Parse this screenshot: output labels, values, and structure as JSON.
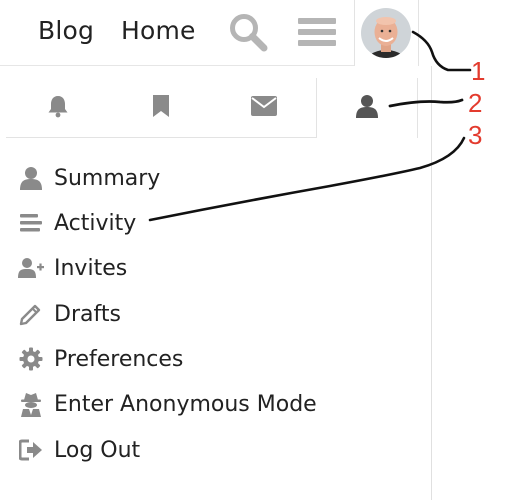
{
  "header": {
    "nav": [
      {
        "label": "Blog"
      },
      {
        "label": "Home"
      }
    ],
    "icons": [
      "search-icon",
      "hamburger-menu-icon"
    ]
  },
  "user_tabs": [
    {
      "icon": "bell-icon",
      "name": "notifications"
    },
    {
      "icon": "bookmark-icon",
      "name": "bookmarks"
    },
    {
      "icon": "envelope-icon",
      "name": "messages"
    },
    {
      "icon": "user-icon",
      "name": "profile",
      "active": true
    }
  ],
  "menu": {
    "items": [
      {
        "label": "Summary",
        "icon": "user-icon"
      },
      {
        "label": "Activity",
        "icon": "activity-lines-icon"
      },
      {
        "label": "Invites",
        "icon": "user-plus-icon"
      },
      {
        "label": "Drafts",
        "icon": "pencil-icon"
      },
      {
        "label": "Preferences",
        "icon": "gear-icon"
      },
      {
        "label": "Enter Anonymous Mode",
        "icon": "anonymous-spy-icon"
      },
      {
        "label": "Log Out",
        "icon": "sign-out-icon"
      }
    ]
  },
  "annotations": [
    "1",
    "2",
    "3"
  ],
  "colors": {
    "icon_gray": "#8a8a8a",
    "annotation_red": "#e33b2e",
    "text": "#222222"
  }
}
